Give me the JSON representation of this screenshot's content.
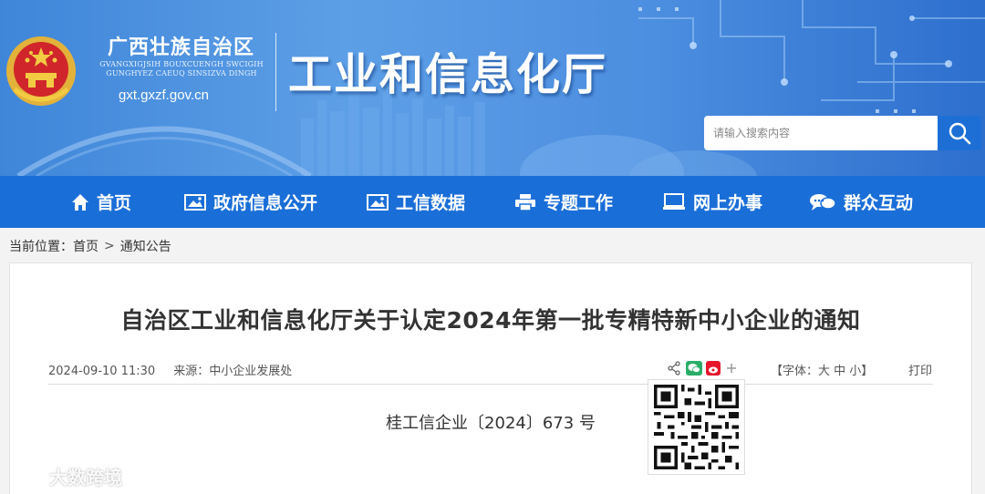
{
  "header": {
    "site_name": "广西壮族自治区",
    "site_roman_line1": "GVANGXIGJSIH BOUXCUENGH SWCIGIH",
    "site_roman_line2": "GUNGHYEZ CAEUQ SINSIZVA DINGH",
    "site_domain": "gxt.gxzf.gov.cn",
    "dept_name": "工业和信息化厅",
    "search_placeholder": "请输入搜索内容",
    "colors": {
      "banner": "#4d8fe0",
      "nav": "#1a6ed7",
      "search_button": "#1d6fd6"
    }
  },
  "nav": {
    "items": [
      {
        "label": "首页",
        "icon": "home-icon"
      },
      {
        "label": "政府信息公开",
        "icon": "image-icon"
      },
      {
        "label": "工信数据",
        "icon": "image-icon"
      },
      {
        "label": "专题工作",
        "icon": "printer-icon"
      },
      {
        "label": "网上办事",
        "icon": "monitor-icon"
      },
      {
        "label": "群众互动",
        "icon": "chat-icon"
      }
    ]
  },
  "breadcrumb": {
    "prefix": "当前位置：",
    "items": [
      "首页",
      "通知公告"
    ],
    "separator": ">"
  },
  "article": {
    "title": "自治区工业和信息化厅关于认定2024年第一批专精特新中小企业的通知",
    "date": "2024-09-10 11:30",
    "source": "来源：中小企业发展处",
    "font_size": "【字体：大 中 小】",
    "print": "打印",
    "doc_number": "桂工信企业〔2024〕673 号",
    "share_icons": [
      "share-icon",
      "wechat-icon",
      "weibo-icon",
      "plus-icon"
    ]
  },
  "watermark": "大数跨境"
}
